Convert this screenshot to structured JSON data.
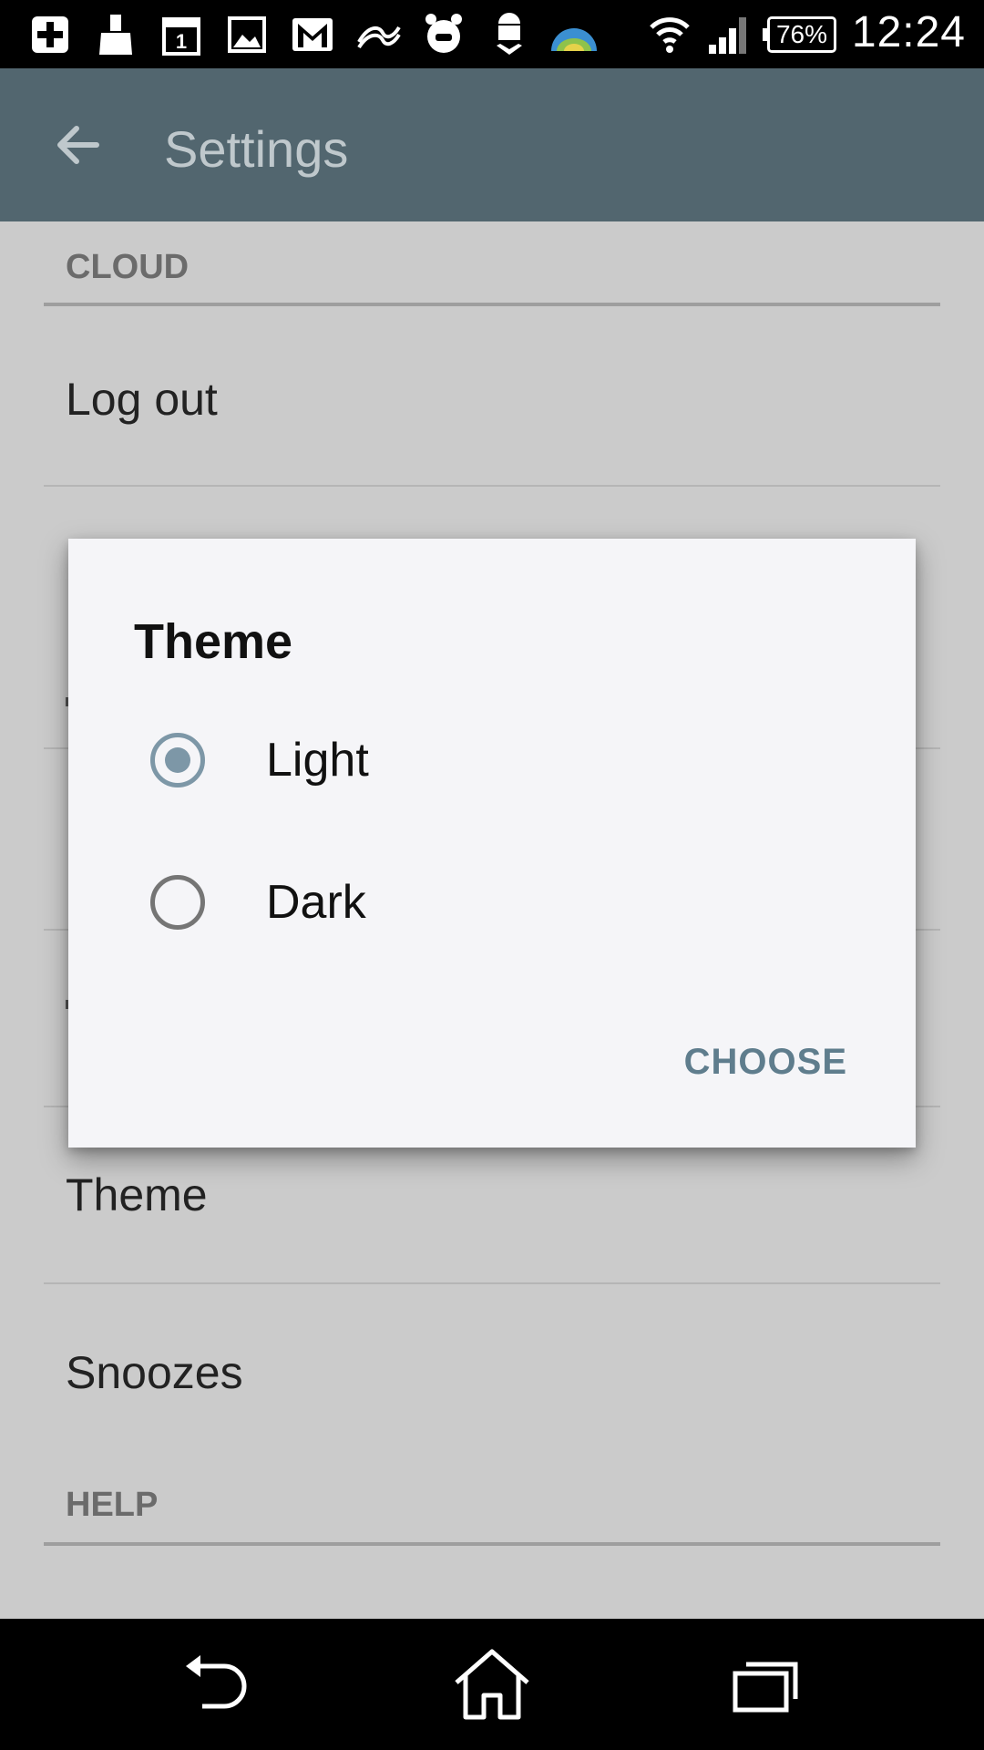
{
  "status_bar": {
    "time": "12:24",
    "battery": "76%",
    "icons": [
      "add-box-icon",
      "cleaner-icon",
      "calendar-icon",
      "gallery-icon",
      "gmail-icon",
      "app-icon",
      "alarm-clock-icon",
      "android-download-icon",
      "globe-app-icon",
      "wifi-icon",
      "signal-icon",
      "battery-icon"
    ],
    "calendar_day": "1"
  },
  "app_bar": {
    "title": "Settings"
  },
  "settings": {
    "cloud_header": "CLOUD",
    "logout_label": "Log out",
    "theme_label": "Theme",
    "snoozes_label": "Snoozes",
    "help_header": "HELP"
  },
  "dialog": {
    "title": "Theme",
    "options": [
      {
        "label": "Light",
        "selected": true
      },
      {
        "label": "Dark",
        "selected": false
      }
    ],
    "choose_label": "CHOOSE"
  },
  "colors": {
    "app_bar": "#52666f",
    "accent": "#7d97a7",
    "scrim_background": "#cbcbcb",
    "dialog_background": "#f5f5f8"
  }
}
